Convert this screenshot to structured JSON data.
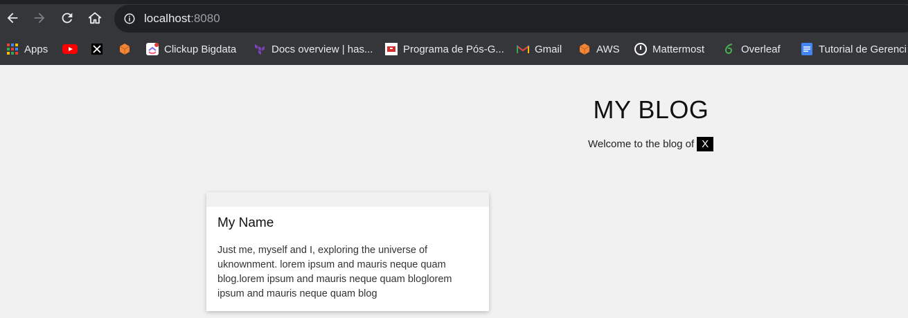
{
  "browser": {
    "url_host": "localhost",
    "url_port": ":8080",
    "bookmarks": [
      {
        "label": "Apps",
        "icon": "apps-grid-icon"
      },
      {
        "label": "",
        "icon": "youtube-icon"
      },
      {
        "label": "",
        "icon": "x-icon"
      },
      {
        "label": "",
        "icon": "aws-box-icon"
      },
      {
        "label": "Clickup Bigdata",
        "icon": "clickup-icon"
      },
      {
        "label": "Docs overview | has...",
        "icon": "terraform-icon"
      },
      {
        "label": "Programa de Pós-G...",
        "icon": "university-icon"
      },
      {
        "label": "Gmail",
        "icon": "gmail-icon"
      },
      {
        "label": "AWS",
        "icon": "aws-box-icon"
      },
      {
        "label": "Mattermost",
        "icon": "mattermost-icon"
      },
      {
        "label": "Overleaf",
        "icon": "overleaf-icon"
      },
      {
        "label": "Tutorial de Gerenci",
        "icon": "docs-icon"
      }
    ]
  },
  "blog": {
    "title": "MY BLOG",
    "welcome_text": "Welcome to the blog of",
    "owner_badge": "X"
  },
  "card": {
    "name": "My Name",
    "bio": "Just me, myself and I, exploring the universe of uknownment. lorem ipsum and mauris neque quam blog.lorem ipsum and mauris neque quam bloglorem ipsum and mauris neque quam blog"
  }
}
